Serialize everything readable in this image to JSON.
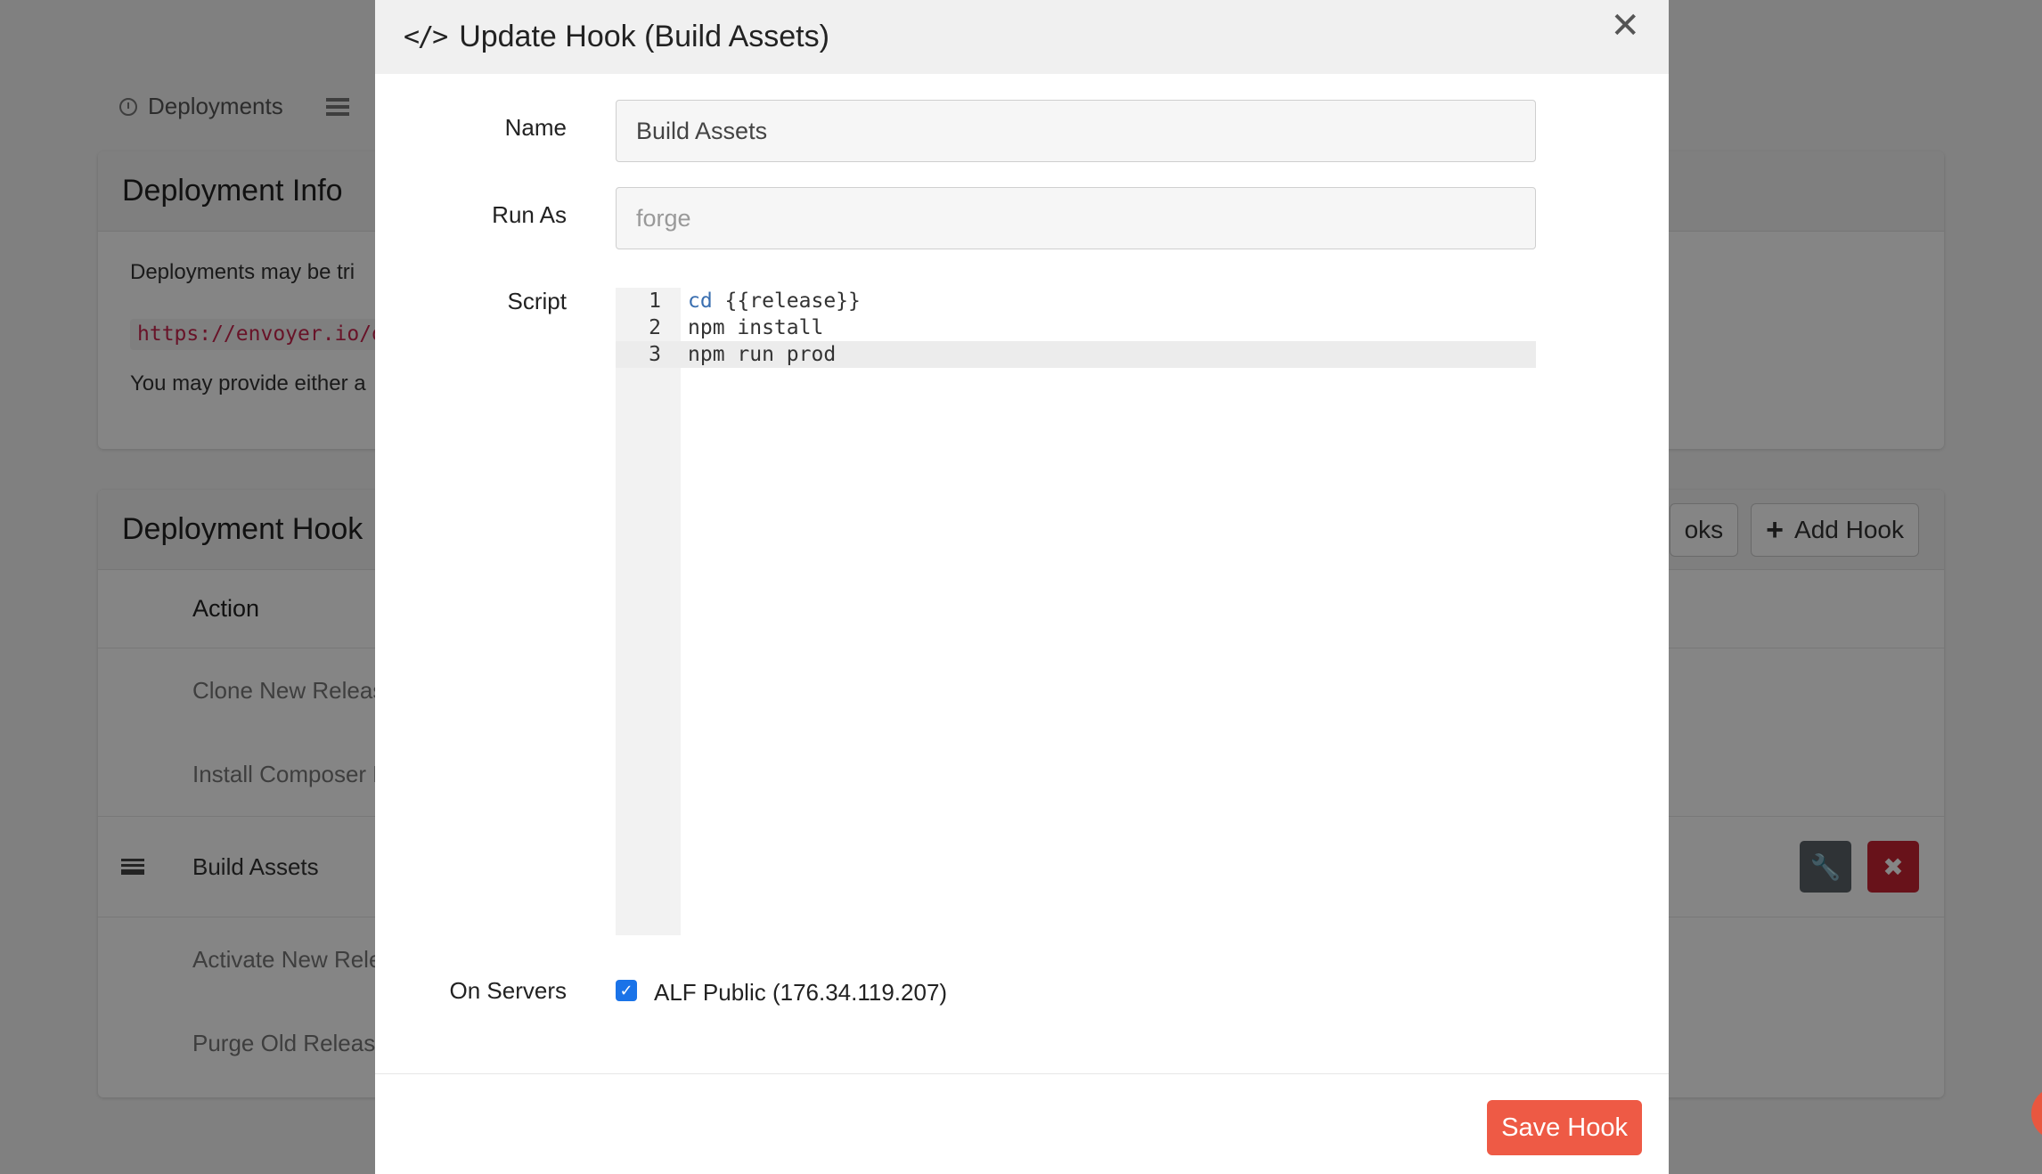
{
  "background": {
    "tabs": [
      {
        "label": "Deployments",
        "icon": "clock-icon"
      },
      {
        "label": "",
        "icon": "server-list-icon"
      }
    ],
    "info_card": {
      "title": "Deployment Info",
      "line1": "Deployments may be tri",
      "url": "https://envoyer.io/d",
      "line2": "You may provide either a"
    },
    "hooks_card": {
      "title": "Deployment Hook",
      "reorder_label": "oks",
      "add_hook_label": "Add Hook",
      "column_action": "Action",
      "rows": [
        {
          "label": "Clone New Releas"
        },
        {
          "label": "Install Composer D"
        },
        {
          "label": "Build Assets"
        },
        {
          "label": "Activate New Rele"
        },
        {
          "label": "Purge Old Releas"
        }
      ]
    }
  },
  "modal": {
    "title": "Update Hook (Build Assets)",
    "form": {
      "name_label": "Name",
      "name_value": "Build Assets",
      "runas_label": "Run As",
      "runas_placeholder": "forge",
      "script_label": "Script",
      "script_lines": [
        {
          "n": "1",
          "kw": "cd",
          "rest": " {{release}}"
        },
        {
          "n": "2",
          "kw": "",
          "rest": "npm install"
        },
        {
          "n": "3",
          "kw": "",
          "rest": "npm run prod"
        }
      ],
      "servers_label": "On Servers",
      "server_option": "ALF Public (176.34.119.207)",
      "server_checked": true
    },
    "save_label": "Save Hook"
  },
  "colors": {
    "accent": "#ee5a45",
    "checkbox": "#1a73e8",
    "danger": "#c82333",
    "keyword": "#3a6fb0"
  }
}
